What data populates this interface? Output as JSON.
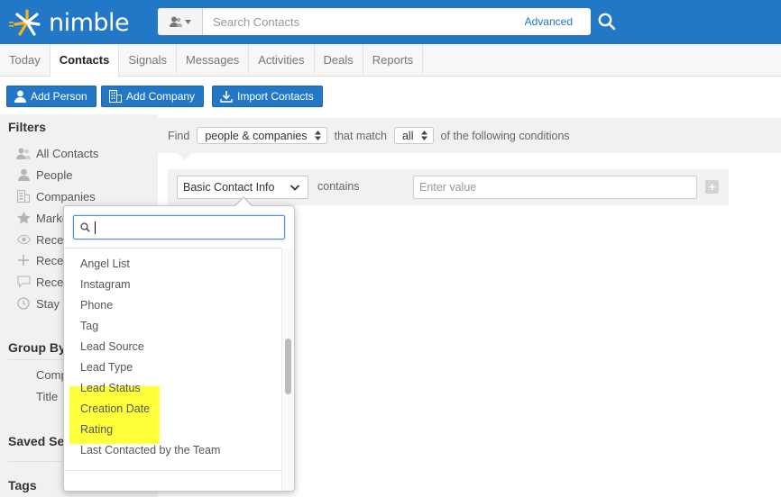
{
  "app": {
    "logo_text": "nimble"
  },
  "search": {
    "placeholder": "Search Contacts",
    "advanced_label": "Advanced"
  },
  "nav": {
    "tabs": [
      {
        "label": "Today"
      },
      {
        "label": "Contacts",
        "active": true
      },
      {
        "label": "Signals"
      },
      {
        "label": "Messages"
      },
      {
        "label": "Activities"
      },
      {
        "label": "Deals"
      },
      {
        "label": "Reports"
      }
    ]
  },
  "toolbar": {
    "add_person": "Add Person",
    "add_company": "Add Company",
    "import_contacts": "Import Contacts"
  },
  "sidebar": {
    "filters_heading": "Filters",
    "items": [
      {
        "label": "All Contacts",
        "icon": "contacts-icon"
      },
      {
        "label": "People",
        "icon": "person-icon"
      },
      {
        "label": "Companies",
        "icon": "building-icon"
      },
      {
        "label": "Marke",
        "icon": "star-icon"
      },
      {
        "label": "Recen",
        "icon": "eye-icon"
      },
      {
        "label": "Recen",
        "icon": "plus-icon"
      },
      {
        "label": "Recen",
        "icon": "comment-icon"
      },
      {
        "label": "Stay i",
        "icon": "clock-icon"
      }
    ],
    "group_by_heading": "Group By",
    "group_by_items": [
      "Comp",
      "Title"
    ],
    "saved_heading": "Saved Se",
    "tags_heading": "Tags"
  },
  "find": {
    "find_label": "Find",
    "entity_select": "people & companies",
    "that_match_label": "that match",
    "match_select": "all",
    "conditions_label": "of the following conditions"
  },
  "condition": {
    "field_select": "Basic Contact Info",
    "operator": "contains",
    "value_placeholder": "Enter value",
    "add_label": "+"
  },
  "dropdown": {
    "search_value": "",
    "options": [
      "Angel List",
      "Instagram",
      "Phone",
      "Tag",
      "Lead Source",
      "Lead Type",
      "Lead Status",
      "Creation Date",
      "Rating",
      "Last Contacted by the Team"
    ],
    "highlighted": [
      "Lead Source",
      "Lead Type",
      "Lead Status"
    ],
    "highlight_color": "#ffff3a"
  },
  "colors": {
    "brand": "#2277c7",
    "sidebar_bg": "#f1f1f1"
  }
}
